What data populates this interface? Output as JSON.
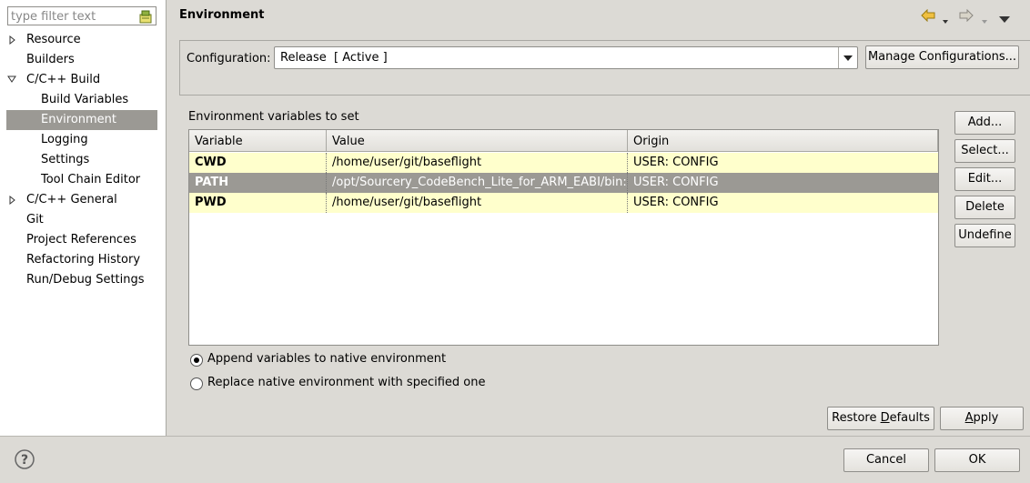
{
  "filter": {
    "placeholder": "type filter text"
  },
  "tree": {
    "items": [
      {
        "label": "Resource",
        "expandable": true,
        "expanded": false
      },
      {
        "label": "Builders"
      },
      {
        "label": "C/C++ Build",
        "expandable": true,
        "expanded": true
      },
      {
        "label": "Build Variables"
      },
      {
        "label": "Environment",
        "selected": true
      },
      {
        "label": "Logging"
      },
      {
        "label": "Settings"
      },
      {
        "label": "Tool Chain Editor"
      },
      {
        "label": "C/C++ General",
        "expandable": true,
        "expanded": false
      },
      {
        "label": "Git"
      },
      {
        "label": "Project References"
      },
      {
        "label": "Refactoring History"
      },
      {
        "label": "Run/Debug Settings"
      }
    ]
  },
  "page": {
    "title": "Environment"
  },
  "config": {
    "label": "Configuration:",
    "value": "Release  [ Active ]",
    "manage_button": "Manage Configurations..."
  },
  "env": {
    "section_label": "Environment variables to set",
    "columns": [
      "Variable",
      "Value",
      "Origin"
    ],
    "rows": [
      {
        "variable": "CWD",
        "value": "/home/user/git/baseflight",
        "origin": "USER: CONFIG"
      },
      {
        "variable": "PATH",
        "value": "/opt/Sourcery_CodeBench_Lite_for_ARM_EABI/bin:/bin",
        "origin": "USER: CONFIG",
        "selected": true
      },
      {
        "variable": "PWD",
        "value": "/home/user/git/baseflight",
        "origin": "USER: CONFIG"
      }
    ],
    "buttons": {
      "add": "Add...",
      "select": "Select...",
      "edit": "Edit...",
      "delete": "Delete",
      "undefine": "Undefine"
    }
  },
  "mode": {
    "append_label": "Append variables to native environment",
    "replace_label": "Replace native environment with specified one",
    "selected": "append"
  },
  "actions": {
    "restore_pre": "Restore ",
    "restore_mn": "D",
    "restore_post": "efaults",
    "apply_mn": "A",
    "apply_post": "pply"
  },
  "dialog": {
    "cancel": "Cancel",
    "ok": "OK"
  },
  "colors": {
    "selection": "#9b9994",
    "config_row": "#ffffcc",
    "arrow_icon": "#f0c040"
  }
}
